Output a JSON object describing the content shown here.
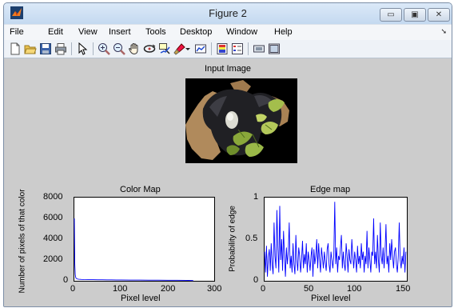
{
  "window": {
    "title": "Figure 2",
    "controls": {
      "minimize": "▭",
      "maximize": "▣",
      "close": "✕"
    }
  },
  "menu": {
    "items": [
      "File",
      "Edit",
      "View",
      "Insert",
      "Tools",
      "Desktop",
      "Window",
      "Help"
    ],
    "arrow": "➘"
  },
  "toolbar": {
    "icons": [
      "new-figure-icon",
      "open-file-icon",
      "save-icon",
      "print-icon",
      "pointer-icon",
      "zoom-in-icon",
      "zoom-out-icon",
      "pan-hand-icon",
      "rotate-3d-icon",
      "data-cursor-icon",
      "brush-icon",
      "brush-dropdown-icon",
      "link-plot-icon",
      "colorbar-icon",
      "legend-icon",
      "hide-plot-tools-icon",
      "show-plot-tools-icon"
    ]
  },
  "figure": {
    "input_title": "Input Image",
    "colormap": {
      "title": "Color Map",
      "xlabel": "Pixel level",
      "ylabel": "Number of pixels of that color",
      "yticks": [
        "8000",
        "6000",
        "4000",
        "2000",
        "0"
      ],
      "xticks": [
        "0",
        "100",
        "200",
        "300"
      ]
    },
    "edgemap": {
      "title": "Edge map",
      "xlabel": "Pixel level",
      "ylabel": "Probability of edge",
      "yticks": [
        "1",
        "0.5",
        "0"
      ],
      "xticks": [
        "0",
        "50",
        "100",
        "150"
      ]
    }
  },
  "chart_data": [
    {
      "type": "line",
      "title": "Color Map",
      "xlabel": "Pixel level",
      "ylabel": "Number of pixels of that color",
      "xlim": [
        0,
        300
      ],
      "ylim": [
        0,
        8000
      ],
      "grid": false,
      "series": [
        {
          "color": "#0000ff",
          "x": [
            0,
            1,
            2,
            3,
            5,
            8,
            10,
            15,
            20,
            30,
            40,
            50,
            60,
            70,
            80,
            90,
            100,
            120,
            140,
            160,
            180,
            200,
            220,
            240,
            255
          ],
          "values": [
            6000,
            1600,
            600,
            300,
            200,
            160,
            150,
            130,
            120,
            110,
            110,
            100,
            100,
            90,
            90,
            80,
            80,
            70,
            70,
            60,
            60,
            50,
            50,
            40,
            20
          ]
        }
      ]
    },
    {
      "type": "line",
      "title": "Edge map",
      "xlabel": "Pixel level",
      "ylabel": "Probability of edge",
      "xlim": [
        0,
        150
      ],
      "ylim": [
        0,
        1
      ],
      "grid": false,
      "series": [
        {
          "color": "#0000ff",
          "x": [
            0,
            1,
            2,
            3,
            4,
            5,
            6,
            7,
            8,
            9,
            10,
            11,
            12,
            13,
            14,
            15,
            16,
            17,
            18,
            19,
            20,
            21,
            22,
            23,
            24,
            25,
            26,
            27,
            28,
            29,
            30,
            31,
            32,
            33,
            34,
            35,
            36,
            37,
            38,
            39,
            40,
            41,
            42,
            43,
            44,
            45,
            46,
            47,
            48,
            49,
            50,
            51,
            52,
            53,
            54,
            55,
            56,
            57,
            58,
            59,
            60,
            61,
            62,
            63,
            64,
            65,
            66,
            67,
            68,
            69,
            70,
            71,
            72,
            73,
            74,
            75,
            76,
            77,
            78,
            79,
            80,
            81,
            82,
            83,
            84,
            85,
            86,
            87,
            88,
            89,
            90,
            91,
            92,
            93,
            94,
            95,
            96,
            97,
            98,
            99,
            100,
            101,
            102,
            103,
            104,
            105,
            106,
            107,
            108,
            109,
            110,
            111,
            112,
            113,
            114,
            115,
            116,
            117,
            118,
            119,
            120,
            121,
            122,
            123,
            124,
            125,
            126,
            127,
            128,
            129,
            130,
            131,
            132,
            133,
            134,
            135,
            136,
            137,
            138,
            139,
            140,
            141,
            142,
            143,
            144,
            145,
            146,
            147,
            148,
            149
          ],
          "values": [
            0.35,
            0.1,
            0.42,
            0.05,
            0.28,
            0.38,
            0.12,
            0.45,
            0.2,
            0.08,
            0.7,
            0.3,
            0.15,
            0.85,
            0.4,
            0.1,
            0.9,
            0.25,
            0.5,
            0.12,
            0.6,
            0.3,
            0.05,
            0.4,
            0.2,
            0.35,
            0.7,
            0.15,
            0.3,
            0.1,
            0.45,
            0.2,
            0.08,
            0.55,
            0.25,
            0.12,
            0.4,
            0.3,
            0.1,
            0.25,
            0.48,
            0.15,
            0.32,
            0.2,
            0.45,
            0.1,
            0.35,
            0.25,
            0.12,
            0.3,
            0.4,
            0.05,
            0.38,
            0.2,
            0.3,
            0.5,
            0.15,
            0.45,
            0.25,
            0.1,
            0.4,
            0.28,
            0.15,
            0.35,
            0.22,
            0.12,
            0.38,
            0.45,
            0.2,
            0.1,
            0.35,
            0.25,
            0.15,
            0.3,
            0.95,
            0.2,
            0.4,
            0.1,
            0.3,
            0.25,
            0.4,
            0.55,
            0.15,
            0.35,
            0.2,
            0.12,
            0.45,
            0.3,
            0.1,
            0.38,
            0.25,
            0.2,
            0.5,
            0.3,
            0.15,
            0.35,
            0.25,
            0.1,
            0.42,
            0.2,
            0.3,
            0.15,
            0.45,
            0.25,
            0.35,
            0.1,
            0.3,
            0.2,
            0.6,
            0.15,
            0.4,
            0.25,
            0.1,
            0.35,
            0.3,
            0.75,
            0.2,
            0.35,
            0.15,
            0.55,
            0.25,
            0.1,
            0.7,
            0.3,
            0.2,
            0.4,
            0.15,
            0.35,
            0.68,
            0.2,
            0.3,
            0.1,
            0.45,
            0.25,
            0.5,
            0.3,
            0.15,
            0.35,
            0.4,
            0.2,
            0.1,
            0.3,
            0.7,
            0.25,
            0.15,
            0.3,
            0.2,
            0.4,
            0.1,
            0.35
          ]
        }
      ]
    }
  ]
}
